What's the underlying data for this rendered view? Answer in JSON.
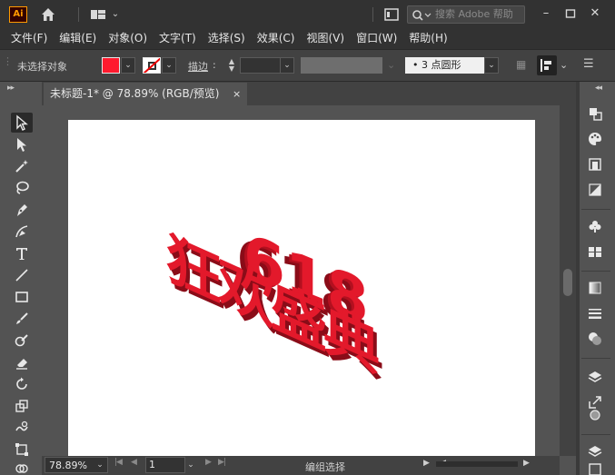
{
  "app": {
    "logo": "Ai",
    "search_placeholder": "搜索 Adobe 帮助"
  },
  "menu": {
    "items": [
      "文件(F)",
      "编辑(E)",
      "对象(O)",
      "文字(T)",
      "选择(S)",
      "效果(C)",
      "视图(V)",
      "窗口(W)",
      "帮助(H)"
    ]
  },
  "control": {
    "selection_status": "未选择对象",
    "fill_color": "#ff1a2e",
    "stroke_label": "描边",
    "brush_value": "3 点圆形"
  },
  "document": {
    "tab_title": "未标题-1* @ 78.89% (RGB/预览)",
    "tab_close": "×"
  },
  "artwork": {
    "number_text": "618",
    "title_chars": [
      "狂",
      "欢",
      "盛",
      "典"
    ],
    "color": "#e3192b"
  },
  "status": {
    "zoom": "78.89%",
    "page": "1",
    "tool_status": "编组选择"
  },
  "icons": {
    "home": "home-icon",
    "workspace": "workspace-switcher-icon",
    "search": "search-icon"
  }
}
